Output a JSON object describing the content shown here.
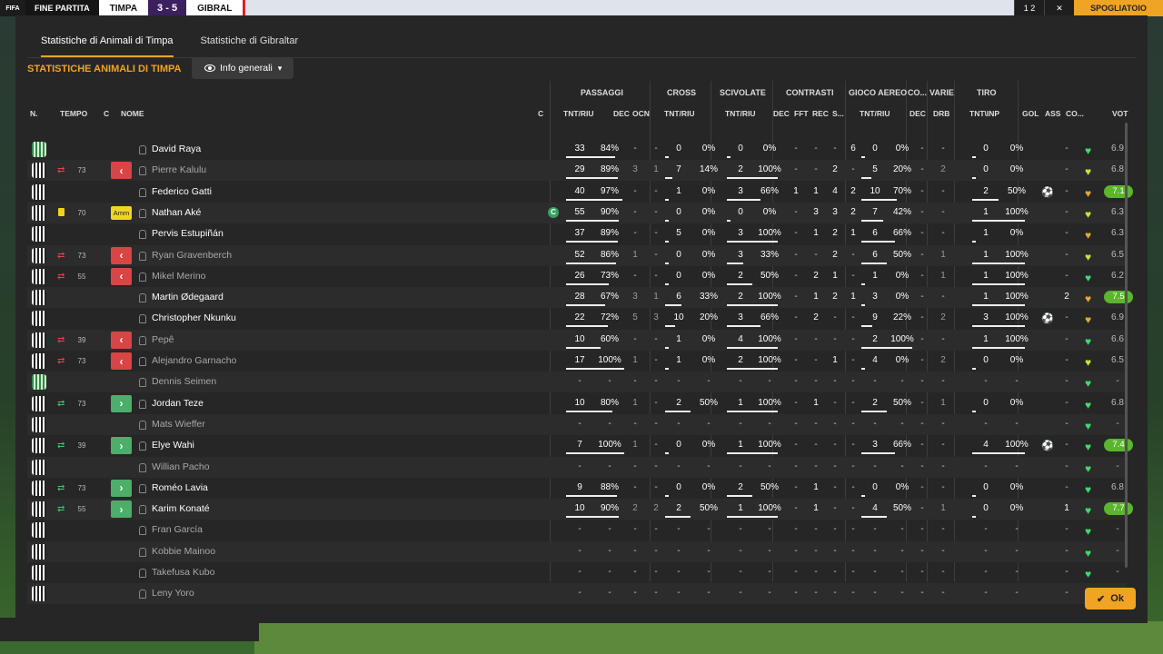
{
  "topbar": {
    "left": "FIFA",
    "status": "FINE PARTITA",
    "team_home": "TIMPA",
    "score": "3 - 5",
    "team_away": "GIBRAL",
    "right_box1": "1 2",
    "right_box2": "✕",
    "right_button": "SPOGLIATOIO"
  },
  "tabs": [
    "Statistiche di Animali di Timpa",
    "Statistiche di Gibraltar"
  ],
  "section_title": "STATISTICHE ANIMALI DI TIMPA",
  "dropdown": {
    "label": "Info generali",
    "icon": "eye-icon"
  },
  "groups": [
    "PASSAGGI",
    "CROSS",
    "SCIVOLATE",
    "CONTRASTI",
    "GIOCO AEREO",
    "CO...",
    "VARIE",
    "TIRO"
  ],
  "columns": {
    "n": "N.",
    "tempo": "TEMPO",
    "c": "C",
    "nome": "NOME",
    "c2": "C",
    "pass_tnt": "TNT/RIU",
    "pass_dec": "DEC",
    "pass_ocn": "OCN",
    "cross_tnt": "TNT/RIU",
    "sciv_tnt": "TNT/RIU",
    "con_dec": "DEC",
    "con_fft": "FFT",
    "con_rec": "REC",
    "con_s": "S...",
    "aereo_tnt": "TNT/RIU",
    "co_dec": "DEC",
    "varie_drb": "DRB",
    "tiro": "TNT\\INP",
    "gol": "GOL",
    "ass": "ASS",
    "co": "CO...",
    "vot": "VOT"
  },
  "players": [
    {
      "name": "David Raya",
      "gk": true,
      "bench": false,
      "sub": "",
      "tempo": "",
      "card": "",
      "cap": false,
      "pass": [
        "33",
        "84%"
      ],
      "pass_fill": 84,
      "pdec": "-",
      "pocn": "-",
      "cross": [
        "0",
        "0%"
      ],
      "cross_fill": 0,
      "sciv": [
        "0",
        "0%"
      ],
      "sciv_fill": 0,
      "cdec": "-",
      "cfft": "-",
      "crec": "-",
      "cs": "6",
      "aereo": [
        "0",
        "0%"
      ],
      "aereo_fill": 0,
      "codec": "-",
      "drb": "-",
      "tiro": [
        "0",
        "0%"
      ],
      "tiro_fill": 0,
      "gol": "",
      "ass": "-",
      "heart": "green",
      "vot": "6.9",
      "pill": false
    },
    {
      "name": "Pierre Kalulu",
      "gk": false,
      "bench": true,
      "sub": "out",
      "tempo": "73",
      "card": "",
      "cap": false,
      "pass": [
        "29",
        "89%"
      ],
      "pass_fill": 89,
      "pdec": "3",
      "pocn": "1",
      "cross": [
        "7",
        "14%"
      ],
      "cross_fill": 14,
      "sciv": [
        "2",
        "100%"
      ],
      "sciv_fill": 100,
      "cdec": "-",
      "cfft": "-",
      "crec": "2",
      "cs": "-",
      "aereo": [
        "5",
        "20%"
      ],
      "aereo_fill": 20,
      "codec": "-",
      "drb": "2",
      "tiro": [
        "0",
        "0%"
      ],
      "tiro_fill": 0,
      "gol": "",
      "ass": "-",
      "heart": "yellow",
      "vot": "6.8",
      "pill": false
    },
    {
      "name": "Federico Gatti",
      "gk": false,
      "bench": false,
      "sub": "",
      "tempo": "",
      "card": "",
      "cap": false,
      "pass": [
        "40",
        "97%"
      ],
      "pass_fill": 97,
      "pdec": "-",
      "pocn": "-",
      "cross": [
        "1",
        "0%"
      ],
      "cross_fill": 0,
      "sciv": [
        "3",
        "66%"
      ],
      "sciv_fill": 66,
      "cdec": "1",
      "cfft": "1",
      "crec": "4",
      "cs": "2",
      "aereo": [
        "10",
        "70%"
      ],
      "aereo_fill": 70,
      "codec": "-",
      "drb": "-",
      "tiro": [
        "2",
        "50%"
      ],
      "tiro_fill": 50,
      "gol": "⚽",
      "ass": "-",
      "heart": "orange",
      "vot": "7.1",
      "pill": true
    },
    {
      "name": "Nathan Aké",
      "gk": false,
      "bench": false,
      "sub": "",
      "tempo": "70",
      "card": "yellow",
      "cap": true,
      "pass": [
        "55",
        "90%"
      ],
      "pass_fill": 90,
      "pdec": "-",
      "pocn": "-",
      "cross": [
        "0",
        "0%"
      ],
      "cross_fill": 0,
      "sciv": [
        "0",
        "0%"
      ],
      "sciv_fill": 0,
      "cdec": "-",
      "cfft": "3",
      "crec": "3",
      "cs": "2",
      "aereo": [
        "7",
        "42%"
      ],
      "aereo_fill": 42,
      "codec": "-",
      "drb": "-",
      "tiro": [
        "1",
        "100%"
      ],
      "tiro_fill": 100,
      "gol": "",
      "ass": "-",
      "heart": "yellow",
      "vot": "6.3",
      "pill": false
    },
    {
      "name": "Pervis Estupiñán",
      "gk": false,
      "bench": false,
      "sub": "",
      "tempo": "",
      "card": "",
      "cap": false,
      "pass": [
        "37",
        "89%"
      ],
      "pass_fill": 89,
      "pdec": "-",
      "pocn": "-",
      "cross": [
        "5",
        "0%"
      ],
      "cross_fill": 0,
      "sciv": [
        "3",
        "100%"
      ],
      "sciv_fill": 100,
      "cdec": "-",
      "cfft": "1",
      "crec": "2",
      "cs": "1",
      "aereo": [
        "6",
        "66%"
      ],
      "aereo_fill": 66,
      "codec": "-",
      "drb": "-",
      "tiro": [
        "1",
        "0%"
      ],
      "tiro_fill": 0,
      "gol": "",
      "ass": "-",
      "heart": "orange",
      "vot": "6.3",
      "pill": false
    },
    {
      "name": "Ryan Gravenberch",
      "gk": false,
      "bench": true,
      "sub": "out",
      "tempo": "73",
      "card": "",
      "cap": false,
      "pass": [
        "52",
        "86%"
      ],
      "pass_fill": 86,
      "pdec": "1",
      "pocn": "-",
      "cross": [
        "0",
        "0%"
      ],
      "cross_fill": 0,
      "sciv": [
        "3",
        "33%"
      ],
      "sciv_fill": 33,
      "cdec": "-",
      "cfft": "-",
      "crec": "2",
      "cs": "-",
      "aereo": [
        "6",
        "50%"
      ],
      "aereo_fill": 50,
      "codec": "-",
      "drb": "1",
      "tiro": [
        "1",
        "100%"
      ],
      "tiro_fill": 100,
      "gol": "",
      "ass": "-",
      "heart": "yellow",
      "vot": "6.5",
      "pill": false
    },
    {
      "name": "Mikel Merino",
      "gk": false,
      "bench": true,
      "sub": "out",
      "tempo": "55",
      "card": "",
      "cap": false,
      "pass": [
        "26",
        "73%"
      ],
      "pass_fill": 73,
      "pdec": "-",
      "pocn": "-",
      "cross": [
        "0",
        "0%"
      ],
      "cross_fill": 0,
      "sciv": [
        "2",
        "50%"
      ],
      "sciv_fill": 50,
      "cdec": "-",
      "cfft": "2",
      "crec": "1",
      "cs": "-",
      "aereo": [
        "1",
        "0%"
      ],
      "aereo_fill": 0,
      "codec": "-",
      "drb": "1",
      "tiro": [
        "1",
        "100%"
      ],
      "tiro_fill": 100,
      "gol": "",
      "ass": "-",
      "heart": "green",
      "vot": "6.2",
      "pill": false
    },
    {
      "name": "Martin Ødegaard",
      "gk": false,
      "bench": false,
      "sub": "",
      "tempo": "",
      "card": "",
      "cap": false,
      "pass": [
        "28",
        "67%"
      ],
      "pass_fill": 67,
      "pdec": "3",
      "pocn": "1",
      "cross": [
        "6",
        "33%"
      ],
      "cross_fill": 33,
      "sciv": [
        "2",
        "100%"
      ],
      "sciv_fill": 100,
      "cdec": "-",
      "cfft": "1",
      "crec": "2",
      "cs": "1",
      "aereo": [
        "3",
        "0%"
      ],
      "aereo_fill": 0,
      "codec": "-",
      "drb": "-",
      "tiro": [
        "1",
        "100%"
      ],
      "tiro_fill": 100,
      "gol": "",
      "ass": "2",
      "heart": "orange",
      "vot": "7.5",
      "pill": true
    },
    {
      "name": "Christopher Nkunku",
      "gk": false,
      "bench": false,
      "sub": "",
      "tempo": "",
      "card": "",
      "cap": false,
      "pass": [
        "22",
        "72%"
      ],
      "pass_fill": 72,
      "pdec": "5",
      "pocn": "3",
      "cross": [
        "10",
        "20%"
      ],
      "cross_fill": 20,
      "sciv": [
        "3",
        "66%"
      ],
      "sciv_fill": 66,
      "cdec": "-",
      "cfft": "2",
      "crec": "-",
      "cs": "-",
      "aereo": [
        "9",
        "22%"
      ],
      "aereo_fill": 22,
      "codec": "-",
      "drb": "2",
      "tiro": [
        "3",
        "100%"
      ],
      "tiro_fill": 100,
      "gol": "⚽",
      "ass": "-",
      "heart": "orange",
      "vot": "6.9",
      "pill": false
    },
    {
      "name": "Pepê",
      "gk": false,
      "bench": true,
      "sub": "out",
      "tempo": "39",
      "card": "",
      "cap": false,
      "pass": [
        "10",
        "60%"
      ],
      "pass_fill": 60,
      "pdec": "-",
      "pocn": "-",
      "cross": [
        "1",
        "0%"
      ],
      "cross_fill": 0,
      "sciv": [
        "4",
        "100%"
      ],
      "sciv_fill": 100,
      "cdec": "-",
      "cfft": "-",
      "crec": "-",
      "cs": "-",
      "aereo": [
        "2",
        "100%"
      ],
      "aereo_fill": 100,
      "codec": "-",
      "drb": "-",
      "tiro": [
        "1",
        "100%"
      ],
      "tiro_fill": 100,
      "gol": "",
      "ass": "-",
      "heart": "green",
      "vot": "6.6",
      "pill": false
    },
    {
      "name": "Alejandro Garnacho",
      "gk": false,
      "bench": true,
      "sub": "out",
      "tempo": "73",
      "card": "",
      "cap": false,
      "pass": [
        "17",
        "100%"
      ],
      "pass_fill": 100,
      "pdec": "1",
      "pocn": "-",
      "cross": [
        "1",
        "0%"
      ],
      "cross_fill": 0,
      "sciv": [
        "2",
        "100%"
      ],
      "sciv_fill": 100,
      "cdec": "-",
      "cfft": "-",
      "crec": "1",
      "cs": "-",
      "aereo": [
        "4",
        "0%"
      ],
      "aereo_fill": 0,
      "codec": "-",
      "drb": "2",
      "tiro": [
        "0",
        "0%"
      ],
      "tiro_fill": 0,
      "gol": "",
      "ass": "-",
      "heart": "yellow",
      "vot": "6.5",
      "pill": false
    },
    {
      "name": "Dennis Seimen",
      "gk": true,
      "bench": true,
      "sub": "",
      "tempo": "",
      "card": "",
      "cap": false,
      "pass": [
        "-",
        "-"
      ],
      "pass_fill": -1,
      "pdec": "-",
      "pocn": "-",
      "cross": [
        "-",
        "-"
      ],
      "cross_fill": -1,
      "sciv": [
        "-",
        "-"
      ],
      "sciv_fill": -1,
      "cdec": "-",
      "cfft": "-",
      "crec": "-",
      "cs": "-",
      "aereo": [
        "-",
        "-"
      ],
      "aereo_fill": -1,
      "codec": "-",
      "drb": "-",
      "tiro": [
        "-",
        "-"
      ],
      "tiro_fill": -1,
      "gol": "",
      "ass": "-",
      "heart": "green",
      "vot": "-",
      "pill": false
    },
    {
      "name": "Jordan Teze",
      "gk": false,
      "bench": false,
      "sub": "in",
      "tempo": "73",
      "card": "",
      "cap": false,
      "pass": [
        "10",
        "80%"
      ],
      "pass_fill": 80,
      "pdec": "1",
      "pocn": "-",
      "cross": [
        "2",
        "50%"
      ],
      "cross_fill": 50,
      "sciv": [
        "1",
        "100%"
      ],
      "sciv_fill": 100,
      "cdec": "-",
      "cfft": "1",
      "crec": "-",
      "cs": "-",
      "aereo": [
        "2",
        "50%"
      ],
      "aereo_fill": 50,
      "codec": "-",
      "drb": "1",
      "tiro": [
        "0",
        "0%"
      ],
      "tiro_fill": 0,
      "gol": "",
      "ass": "-",
      "heart": "green",
      "vot": "6.8",
      "pill": false
    },
    {
      "name": "Mats Wieffer",
      "gk": false,
      "bench": true,
      "sub": "",
      "tempo": "",
      "card": "",
      "cap": false,
      "pass": [
        "-",
        "-"
      ],
      "pass_fill": -1,
      "pdec": "-",
      "pocn": "-",
      "cross": [
        "-",
        "-"
      ],
      "cross_fill": -1,
      "sciv": [
        "-",
        "-"
      ],
      "sciv_fill": -1,
      "cdec": "-",
      "cfft": "-",
      "crec": "-",
      "cs": "-",
      "aereo": [
        "-",
        "-"
      ],
      "aereo_fill": -1,
      "codec": "-",
      "drb": "-",
      "tiro": [
        "-",
        "-"
      ],
      "tiro_fill": -1,
      "gol": "",
      "ass": "-",
      "heart": "green",
      "vot": "-",
      "pill": false
    },
    {
      "name": "Elye Wahi",
      "gk": false,
      "bench": false,
      "sub": "in",
      "tempo": "39",
      "card": "",
      "cap": false,
      "pass": [
        "7",
        "100%"
      ],
      "pass_fill": 100,
      "pdec": "1",
      "pocn": "-",
      "cross": [
        "0",
        "0%"
      ],
      "cross_fill": 0,
      "sciv": [
        "1",
        "100%"
      ],
      "sciv_fill": 100,
      "cdec": "-",
      "cfft": "-",
      "crec": "-",
      "cs": "-",
      "aereo": [
        "3",
        "66%"
      ],
      "aereo_fill": 66,
      "codec": "-",
      "drb": "-",
      "tiro": [
        "4",
        "100%"
      ],
      "tiro_fill": 100,
      "gol": "⚽",
      "ass": "-",
      "heart": "green",
      "vot": "7.4",
      "pill": true
    },
    {
      "name": "Willian Pacho",
      "gk": false,
      "bench": true,
      "sub": "",
      "tempo": "",
      "card": "",
      "cap": false,
      "pass": [
        "-",
        "-"
      ],
      "pass_fill": -1,
      "pdec": "-",
      "pocn": "-",
      "cross": [
        "-",
        "-"
      ],
      "cross_fill": -1,
      "sciv": [
        "-",
        "-"
      ],
      "sciv_fill": -1,
      "cdec": "-",
      "cfft": "-",
      "crec": "-",
      "cs": "-",
      "aereo": [
        "-",
        "-"
      ],
      "aereo_fill": -1,
      "codec": "-",
      "drb": "-",
      "tiro": [
        "-",
        "-"
      ],
      "tiro_fill": -1,
      "gol": "",
      "ass": "-",
      "heart": "green",
      "vot": "-",
      "pill": false
    },
    {
      "name": "Roméo Lavia",
      "gk": false,
      "bench": false,
      "sub": "in",
      "tempo": "73",
      "card": "",
      "cap": false,
      "pass": [
        "9",
        "88%"
      ],
      "pass_fill": 88,
      "pdec": "-",
      "pocn": "-",
      "cross": [
        "0",
        "0%"
      ],
      "cross_fill": 0,
      "sciv": [
        "2",
        "50%"
      ],
      "sciv_fill": 50,
      "cdec": "-",
      "cfft": "1",
      "crec": "-",
      "cs": "-",
      "aereo": [
        "0",
        "0%"
      ],
      "aereo_fill": 0,
      "codec": "-",
      "drb": "-",
      "tiro": [
        "0",
        "0%"
      ],
      "tiro_fill": 0,
      "gol": "",
      "ass": "-",
      "heart": "green",
      "vot": "6.8",
      "pill": false
    },
    {
      "name": "Karim Konaté",
      "gk": false,
      "bench": false,
      "sub": "in",
      "tempo": "55",
      "card": "",
      "cap": false,
      "pass": [
        "10",
        "90%"
      ],
      "pass_fill": 90,
      "pdec": "2",
      "pocn": "2",
      "cross": [
        "2",
        "50%"
      ],
      "cross_fill": 50,
      "sciv": [
        "1",
        "100%"
      ],
      "sciv_fill": 100,
      "cdec": "-",
      "cfft": "1",
      "crec": "-",
      "cs": "-",
      "aereo": [
        "4",
        "50%"
      ],
      "aereo_fill": 50,
      "codec": "-",
      "drb": "1",
      "tiro": [
        "0",
        "0%"
      ],
      "tiro_fill": 0,
      "gol": "",
      "ass": "1",
      "heart": "green",
      "vot": "7.7",
      "pill": true
    },
    {
      "name": "Fran García",
      "gk": false,
      "bench": true,
      "sub": "",
      "tempo": "",
      "card": "",
      "cap": false,
      "pass": [
        "-",
        "-"
      ],
      "pass_fill": -1,
      "pdec": "-",
      "pocn": "-",
      "cross": [
        "-",
        "-"
      ],
      "cross_fill": -1,
      "sciv": [
        "-",
        "-"
      ],
      "sciv_fill": -1,
      "cdec": "-",
      "cfft": "-",
      "crec": "-",
      "cs": "-",
      "aereo": [
        "-",
        "-"
      ],
      "aereo_fill": -1,
      "codec": "-",
      "drb": "-",
      "tiro": [
        "-",
        "-"
      ],
      "tiro_fill": -1,
      "gol": "",
      "ass": "-",
      "heart": "green",
      "vot": "-",
      "pill": false
    },
    {
      "name": "Kobbie Mainoo",
      "gk": false,
      "bench": true,
      "sub": "",
      "tempo": "",
      "card": "",
      "cap": false,
      "pass": [
        "-",
        "-"
      ],
      "pass_fill": -1,
      "pdec": "-",
      "pocn": "-",
      "cross": [
        "-",
        "-"
      ],
      "cross_fill": -1,
      "sciv": [
        "-",
        "-"
      ],
      "sciv_fill": -1,
      "cdec": "-",
      "cfft": "-",
      "crec": "-",
      "cs": "-",
      "aereo": [
        "-",
        "-"
      ],
      "aereo_fill": -1,
      "codec": "-",
      "drb": "-",
      "tiro": [
        "-",
        "-"
      ],
      "tiro_fill": -1,
      "gol": "",
      "ass": "-",
      "heart": "green",
      "vot": "-",
      "pill": false
    },
    {
      "name": "Takefusa Kubo",
      "gk": false,
      "bench": true,
      "sub": "",
      "tempo": "",
      "card": "",
      "cap": false,
      "pass": [
        "-",
        "-"
      ],
      "pass_fill": -1,
      "pdec": "-",
      "pocn": "-",
      "cross": [
        "-",
        "-"
      ],
      "cross_fill": -1,
      "sciv": [
        "-",
        "-"
      ],
      "sciv_fill": -1,
      "cdec": "-",
      "cfft": "-",
      "crec": "-",
      "cs": "-",
      "aereo": [
        "-",
        "-"
      ],
      "aereo_fill": -1,
      "codec": "-",
      "drb": "-",
      "tiro": [
        "-",
        "-"
      ],
      "tiro_fill": -1,
      "gol": "",
      "ass": "-",
      "heart": "green",
      "vot": "-",
      "pill": false
    },
    {
      "name": "Leny Yoro",
      "gk": false,
      "bench": true,
      "sub": "",
      "tempo": "",
      "card": "",
      "cap": false,
      "pass": [
        "-",
        "-"
      ],
      "pass_fill": -1,
      "pdec": "-",
      "pocn": "-",
      "cross": [
        "-",
        "-"
      ],
      "cross_fill": -1,
      "sciv": [
        "-",
        "-"
      ],
      "sciv_fill": -1,
      "cdec": "-",
      "cfft": "-",
      "crec": "-",
      "cs": "-",
      "aereo": [
        "-",
        "-"
      ],
      "aereo_fill": -1,
      "codec": "-",
      "drb": "-",
      "tiro": [
        "-",
        "-"
      ],
      "tiro_fill": -1,
      "gol": "",
      "ass": "-",
      "heart": "green",
      "vot": "-",
      "pill": false
    }
  ],
  "labels": {
    "amm": "Amm",
    "cap": "C"
  },
  "ok_button": "Ok",
  "colors": {
    "accent": "#f0a424",
    "panel": "#262626",
    "sub_out": "#d94545",
    "sub_in": "#4cae6a",
    "rating_pill": "#5bb52d",
    "heart_green": "#3ddc6a",
    "heart_yellow": "#cbe03c",
    "heart_orange": "#e2a83a"
  }
}
